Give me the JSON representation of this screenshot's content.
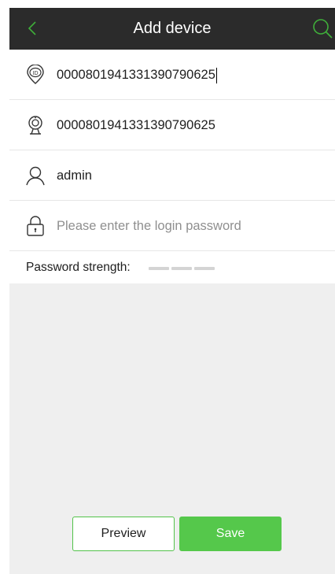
{
  "header": {
    "title": "Add device"
  },
  "form": {
    "device_id": "000080194133139079062​5",
    "camera_id": "0000801941331390790625",
    "username": "admin",
    "password_placeholder": "Please enter the login password"
  },
  "strength": {
    "label": "Password strength:"
  },
  "buttons": {
    "preview": "Preview",
    "save": "Save"
  },
  "colors": {
    "accent": "#55c84b",
    "header_bg": "#2b2b2b",
    "panel_bg": "#efefef"
  }
}
